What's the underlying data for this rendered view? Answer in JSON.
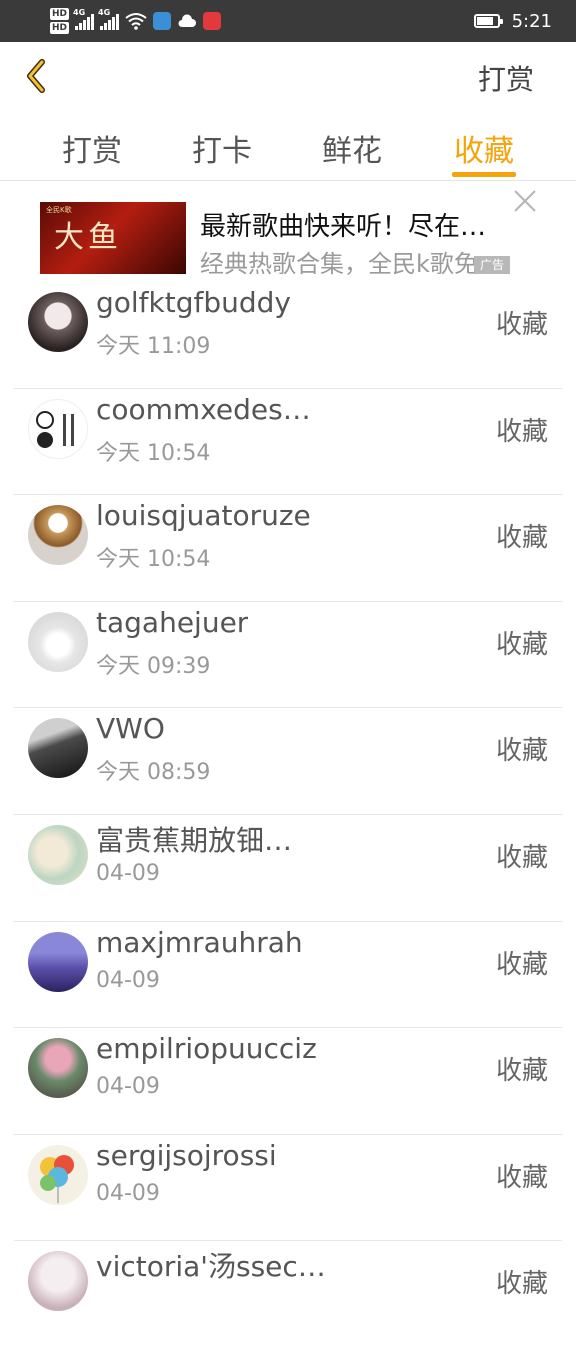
{
  "status_bar": {
    "hd_1": "HD",
    "hd_2": "HD",
    "net_1": "4G",
    "net_2": "4G",
    "time": "5:21",
    "battery_level": 0.8
  },
  "header": {
    "title": "打赏"
  },
  "tabs": [
    {
      "label": "打赏",
      "active": false
    },
    {
      "label": "打卡",
      "active": false
    },
    {
      "label": "鲜花",
      "active": false
    },
    {
      "label": "收藏",
      "active": true
    }
  ],
  "ad": {
    "thumb_title": "大鱼",
    "thumb_brand": "全民K歌",
    "title": "最新歌曲快来听！尽在…",
    "subtitle": "经典热歌合集，全民k歌免",
    "badge": "广告"
  },
  "list": [
    {
      "name": "golfktgfbuddy",
      "time": "今天 11:09",
      "action": "收藏"
    },
    {
      "name": "coommxedes…",
      "time": "今天 10:54",
      "action": "收藏"
    },
    {
      "name": "louisqjuatoruze",
      "time": "今天 10:54",
      "action": "收藏"
    },
    {
      "name": "tagahejuer",
      "time": "今天 09:39",
      "action": "收藏"
    },
    {
      "name": "VWO",
      "time": "今天 08:59",
      "action": "收藏"
    },
    {
      "name": "富贵蕉期放钿…",
      "time": "04-09",
      "action": "收藏"
    },
    {
      "name": "maxjmrauhrah",
      "time": "04-09",
      "action": "收藏"
    },
    {
      "name": "empilriopuucciz",
      "time": "04-09",
      "action": "收藏"
    },
    {
      "name": "sergijsojrossi",
      "time": "04-09",
      "action": "收藏"
    },
    {
      "name": "victoria'汤ssec…",
      "time": "",
      "action": "收藏"
    }
  ],
  "colors": {
    "accent": "#f5a40c",
    "status_bar_bg": "#3a3a3a"
  }
}
